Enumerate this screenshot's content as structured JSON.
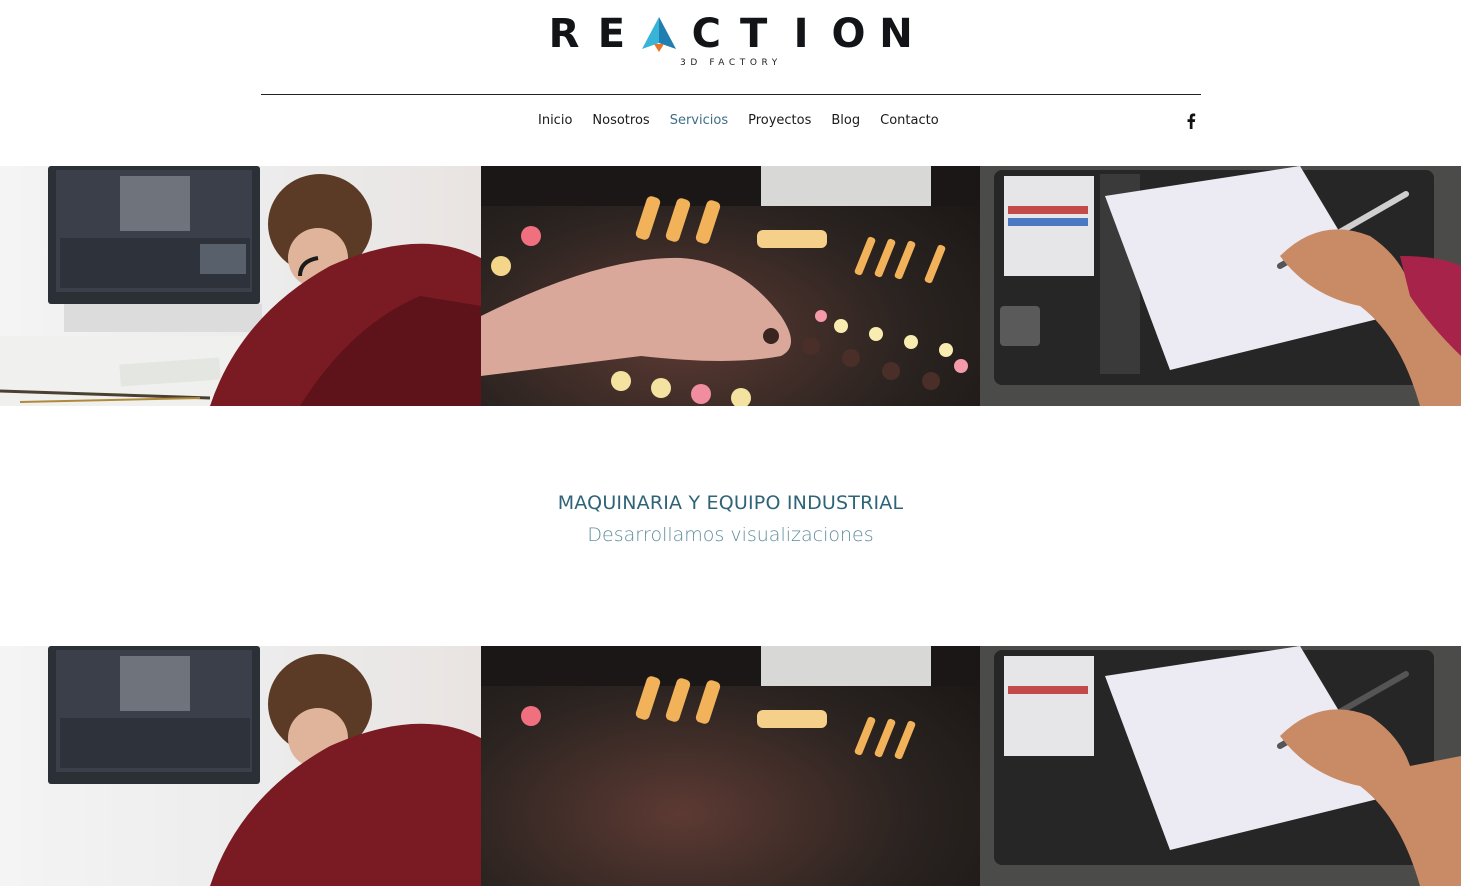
{
  "logo": {
    "letters": [
      "R",
      "E",
      "",
      "C",
      "T",
      "I",
      "O",
      "N"
    ],
    "subtitle": "3D FACTORY"
  },
  "nav": {
    "items": [
      {
        "label": "Inicio",
        "active": false
      },
      {
        "label": "Nosotros",
        "active": false
      },
      {
        "label": "Servicios",
        "active": true
      },
      {
        "label": "Proyectos",
        "active": false
      },
      {
        "label": "Blog",
        "active": false
      },
      {
        "label": "Contacto",
        "active": false
      }
    ],
    "social_icon": "facebook-icon"
  },
  "content": {
    "headline": "MAQUINARIA Y EQUIPO INDUSTRIAL",
    "subheadline": "Desarrollamos visualizaciones"
  },
  "banner": {
    "images": [
      "video-editing-photo",
      "audio-mixer-photo",
      "drawing-tablet-photo"
    ]
  },
  "colors": {
    "accent": "#3d6f86",
    "headline": "#2f6478",
    "subheadline": "#5f8c9c",
    "logo_mark_blue": "#2aa0c8",
    "logo_mark_orange": "#e8742a"
  }
}
